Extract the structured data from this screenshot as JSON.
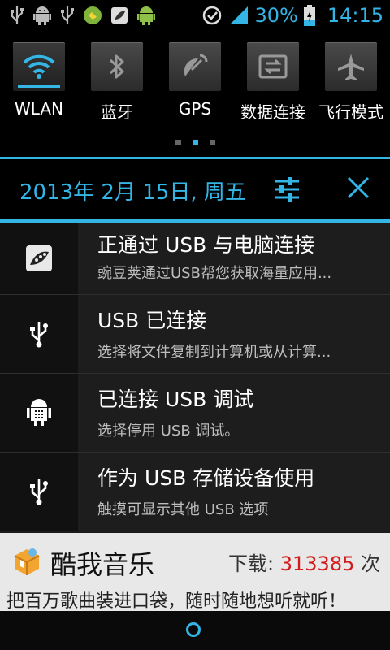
{
  "statusbar": {
    "battery_pct": "30%",
    "time": "14:15",
    "accent": "#33b5e5",
    "left_icons": [
      "usb-icon",
      "android-robot-icon",
      "usb-icon",
      "app-green-icon",
      "wandoujia-icon",
      "android-robot-icon"
    ],
    "right_icons": [
      "sync-icon",
      "signal-icon",
      "battery-charging-icon"
    ]
  },
  "quick_settings": [
    {
      "label": "WLAN",
      "icon": "wifi-icon",
      "active": true
    },
    {
      "label": "蓝牙",
      "icon": "bluetooth-icon",
      "active": false
    },
    {
      "label": "GPS",
      "icon": "gps-icon",
      "active": false
    },
    {
      "label": "数据连接",
      "icon": "data-connection-icon",
      "active": false
    },
    {
      "label": "飞行模式",
      "icon": "airplane-icon",
      "active": false
    }
  ],
  "pager": {
    "count": 3,
    "active": 1
  },
  "header": {
    "date": "2013年 2月 15日, 周五",
    "settings_icon": "sliders-icon",
    "clear_icon": "close-icon"
  },
  "notifications": [
    {
      "title": "正通过 USB 与电脑连接",
      "text": "豌豆荚通过USB帮您获取海量应用...",
      "icon": "wandoujia-icon"
    },
    {
      "title": "USB 已连接",
      "text": "选择将文件复制到计算机或从计算...",
      "icon": "usb-icon"
    },
    {
      "title": "已连接 USB 调试",
      "text": "选择停用 USB 调试。",
      "icon": "android-debug-icon"
    },
    {
      "title": "作为 USB 存储设备使用",
      "text": "触摸可显示其他 USB 选项",
      "icon": "usb-icon"
    }
  ],
  "ad": {
    "name": "酷我音乐",
    "download_label": "下载: ",
    "download_count": "313385",
    "download_suffix": " 次",
    "slogan": "把百万歌曲装进口袋，随时随地想听就听！",
    "count_color": "#d21c1c"
  },
  "navbar": {
    "home_icon": "home-ring-icon"
  }
}
